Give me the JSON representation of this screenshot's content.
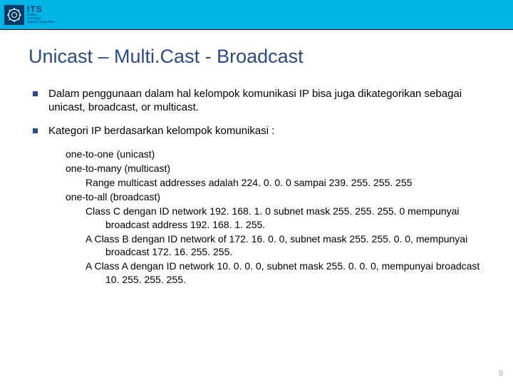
{
  "header": {
    "logo_abbrev": "ITS",
    "logo_sub1": "Institut",
    "logo_sub2": "Teknologi",
    "logo_sub3": "Sepuluh Nopember"
  },
  "title": "Unicast – Multi.Cast - Broadcast",
  "bullets": {
    "b1": "Dalam penggunaan dalam hal kelompok komunikasi IP bisa juga dikategorikan sebagai unicast, broadcast, or multicast.",
    "b2": "Kategori IP berdasarkan kelompok komunikasi :"
  },
  "sub": {
    "s1": "one-to-one (unicast)",
    "s2": "one-to-many (multicast)",
    "s3": "Range multicast addresses adalah 224. 0. 0. 0 sampai 239. 255. 255. 255",
    "s4": "one-to-all (broadcast)",
    "s5": "Class C dengan ID network 192. 168. 1. 0 subnet mask 255. 255. 255. 0 mempunyai broadcast address 192. 168. 1. 255.",
    "s6": "A Class B dengan ID network of 172. 16. 0. 0, subnet mask 255. 255. 0. 0, mempunyai broadcast 172. 16. 255. 255.",
    "s7": "A Class A dengan ID network 10. 0. 0. 0, subnet mask 255. 0. 0. 0, mempunyai broadcast 10. 255. 255. 255."
  },
  "page_number": "9"
}
